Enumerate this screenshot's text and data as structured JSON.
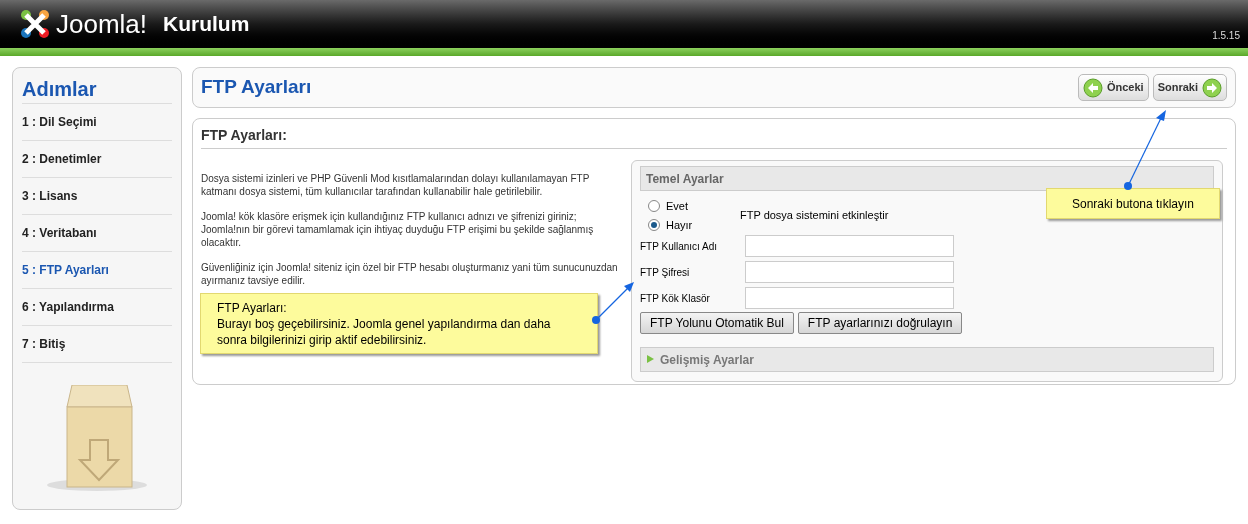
{
  "header": {
    "logo_text": "Joomla!",
    "title": "Kurulum",
    "version": "1.5.15"
  },
  "sidebar": {
    "title": "Adımlar",
    "steps": [
      {
        "label": "1 : Dil Seçimi",
        "selected": false
      },
      {
        "label": "2 : Denetimler",
        "selected": false
      },
      {
        "label": "3 : Lisans",
        "selected": false
      },
      {
        "label": "4 : Veritabanı",
        "selected": false
      },
      {
        "label": "5 : FTP Ayarları",
        "selected": true
      },
      {
        "label": "6 : Yapılandırma",
        "selected": false
      },
      {
        "label": "7 : Bitiş",
        "selected": false
      }
    ]
  },
  "page_title": "FTP Ayarları",
  "nav_buttons": [
    {
      "label": "Önceki",
      "kind": "prev"
    },
    {
      "label": "Sonraki",
      "kind": "next"
    }
  ],
  "section": {
    "title": "FTP Ayarları:",
    "paragraphs": [
      "Dosya sistemi izinleri ve PHP Güvenli Mod kısıtlamalarından dolayı kullanılamayan FTP katmanı dosya sistemi, tüm kullanıcılar tarafından kullanabilir hale getirilebilir.",
      "Joomla! kök klasöre erişmek için kullandığınız FTP kullanıcı adnızı ve şifrenizi giriniz; Joomla!nın bir görevi tamamlamak için ihtiyaç duyduğu FTP erişimi bu şekilde sağlanmış olacaktır.",
      "Güvenliğiniz için Joomla! siteniz için özel bir FTP hesabı oluşturmanız yani tüm sunucunuzdan ayırmanız tavsiye edilir."
    ]
  },
  "panel": {
    "title": "Temel Ayarlar",
    "radios": [
      {
        "label": "Evet",
        "selected": false
      },
      {
        "label": "Hayır",
        "selected": true
      }
    ],
    "radio_caption": "FTP dosya sistemini etkinleştir",
    "fields": [
      {
        "label": "FTP Kullanıcı Adı"
      },
      {
        "label": "FTP Şifresi"
      },
      {
        "label": "FTP Kök Klasör"
      }
    ],
    "buttons": [
      "FTP Yolunu Otomatik Bul",
      "FTP ayarlarınızı doğrulayın"
    ],
    "advanced": {
      "title": "Gelişmiş Ayarlar",
      "expanded": false
    }
  },
  "callouts": [
    {
      "lines": [
        "FTP Ayarları:",
        "Burayı boş geçebilirsiniz. Joomla genel yapılandırma dan daha sonra bilgilerinizi girip aktif edebilirsiniz."
      ]
    },
    {
      "lines": [
        "Sonraki butona tıklayın"
      ]
    }
  ]
}
